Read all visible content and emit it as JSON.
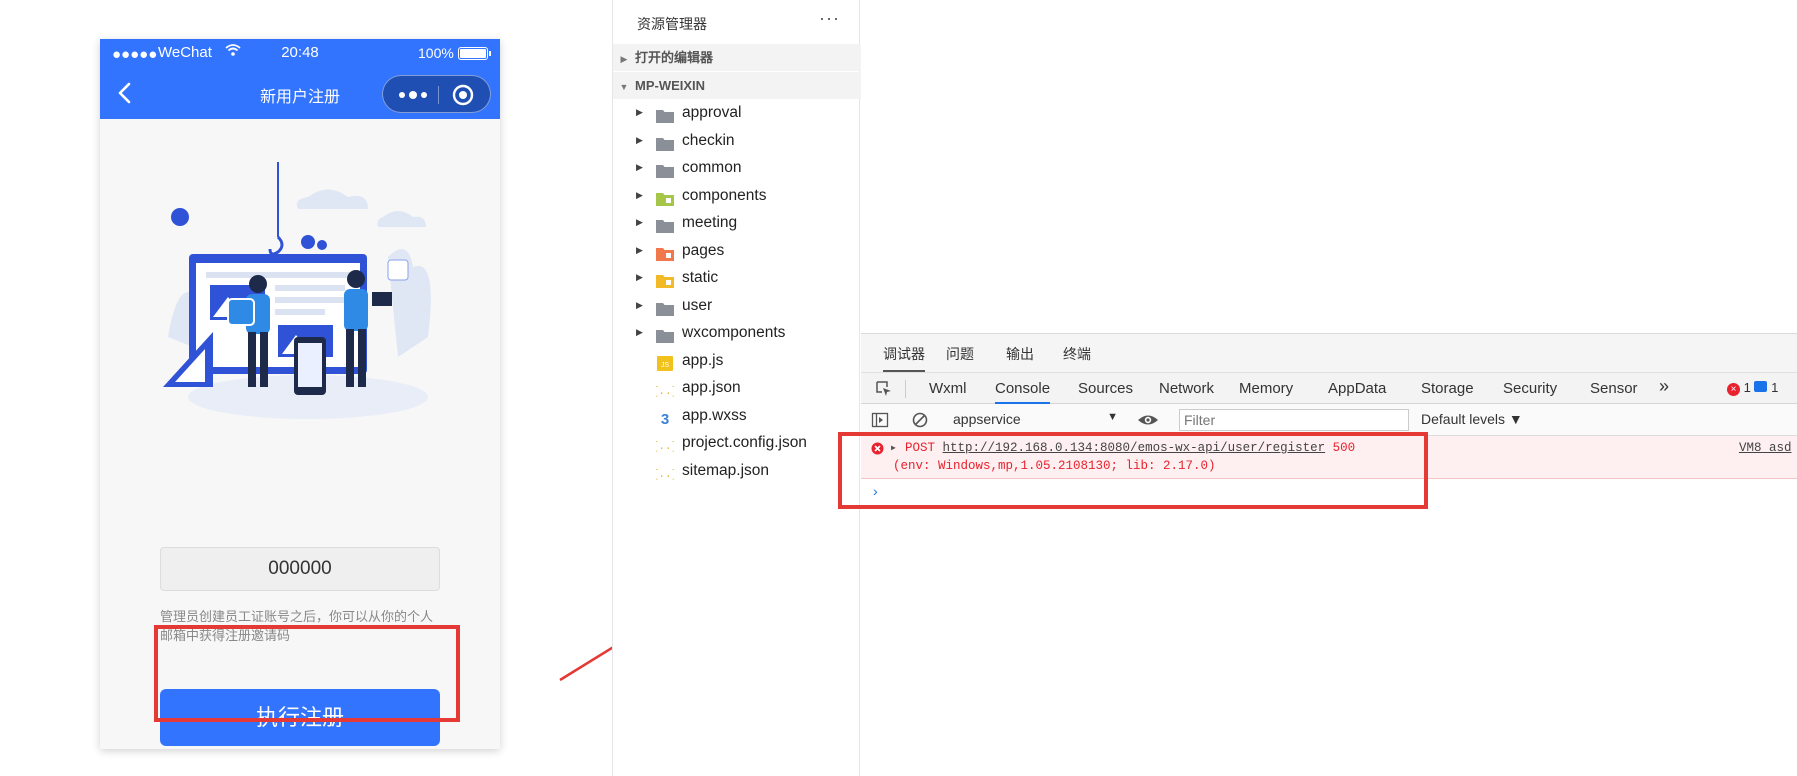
{
  "phone": {
    "status": {
      "carrier": "WeChat",
      "time": "20:48",
      "battery": "100%"
    },
    "nav": {
      "title": "新用户注册"
    },
    "form": {
      "code_value": "000000",
      "hint": "管理员创建员工证账号之后，你可以从你的个人邮箱中获得注册邀请码",
      "register_label": "执行注册"
    }
  },
  "explorer": {
    "title": "资源管理器",
    "more": "···",
    "sections": {
      "open_editors": "打开的编辑器",
      "project": "MP-WEIXIN"
    },
    "items": [
      {
        "name": "approval",
        "type": "folder"
      },
      {
        "name": "checkin",
        "type": "folder"
      },
      {
        "name": "common",
        "type": "folder"
      },
      {
        "name": "components",
        "type": "folder-components"
      },
      {
        "name": "meeting",
        "type": "folder"
      },
      {
        "name": "pages",
        "type": "folder-pages"
      },
      {
        "name": "static",
        "type": "folder-static"
      },
      {
        "name": "user",
        "type": "folder"
      },
      {
        "name": "wxcomponents",
        "type": "folder"
      },
      {
        "name": "app.js",
        "type": "js"
      },
      {
        "name": "app.json",
        "type": "json"
      },
      {
        "name": "app.wxss",
        "type": "css"
      },
      {
        "name": "project.config.json",
        "type": "json"
      },
      {
        "name": "sitemap.json",
        "type": "json"
      }
    ]
  },
  "devtools": {
    "top_tabs": [
      "调试器",
      "问题",
      "输出",
      "终端"
    ],
    "panel_tabs": [
      "Wxml",
      "Console",
      "Sources",
      "Network",
      "Memory",
      "AppData",
      "Storage",
      "Security",
      "Sensor"
    ],
    "more_tabs": "»",
    "error_count": "1",
    "info_count": "1",
    "context": "appservice",
    "filter_placeholder": "Filter",
    "levels": "Default levels",
    "log": {
      "method": "POST",
      "url": "http://192.168.0.134:8080/emos-wx-api/user/register",
      "status": "500",
      "env": "(env: Windows,mp,1.05.2108130; lib: 2.17.0)",
      "source": "VM8 asd"
    },
    "prompt": "›"
  },
  "colors": {
    "brand": "#3374ff",
    "annotation": "#e53935",
    "error": "#e8222f"
  }
}
